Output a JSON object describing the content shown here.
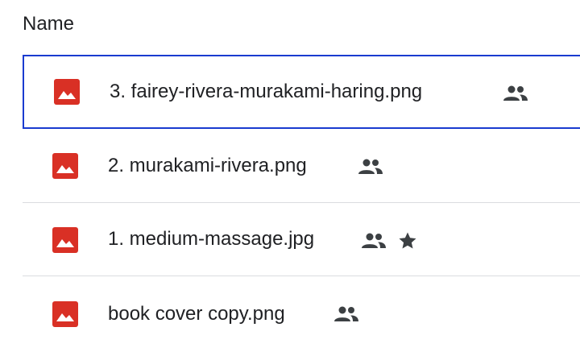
{
  "header": {
    "name_label": "Name"
  },
  "files": [
    {
      "name": "3. fairey-rivera-murakami-haring.png",
      "shared": true,
      "starred": false,
      "selected": true
    },
    {
      "name": "2. murakami-rivera.png",
      "shared": true,
      "starred": false,
      "selected": false
    },
    {
      "name": "1. medium-massage.jpg",
      "shared": true,
      "starred": true,
      "selected": false
    },
    {
      "name": "book cover copy.png",
      "shared": true,
      "starred": false,
      "selected": false
    }
  ],
  "icons": {
    "file_type": "image-file-icon",
    "shared": "shared-people-icon",
    "starred": "star-icon"
  },
  "colors": {
    "image_file": "#d93025",
    "selection_border": "#1a3bd0",
    "divider": "#dadce0",
    "badge": "#3c4043"
  }
}
